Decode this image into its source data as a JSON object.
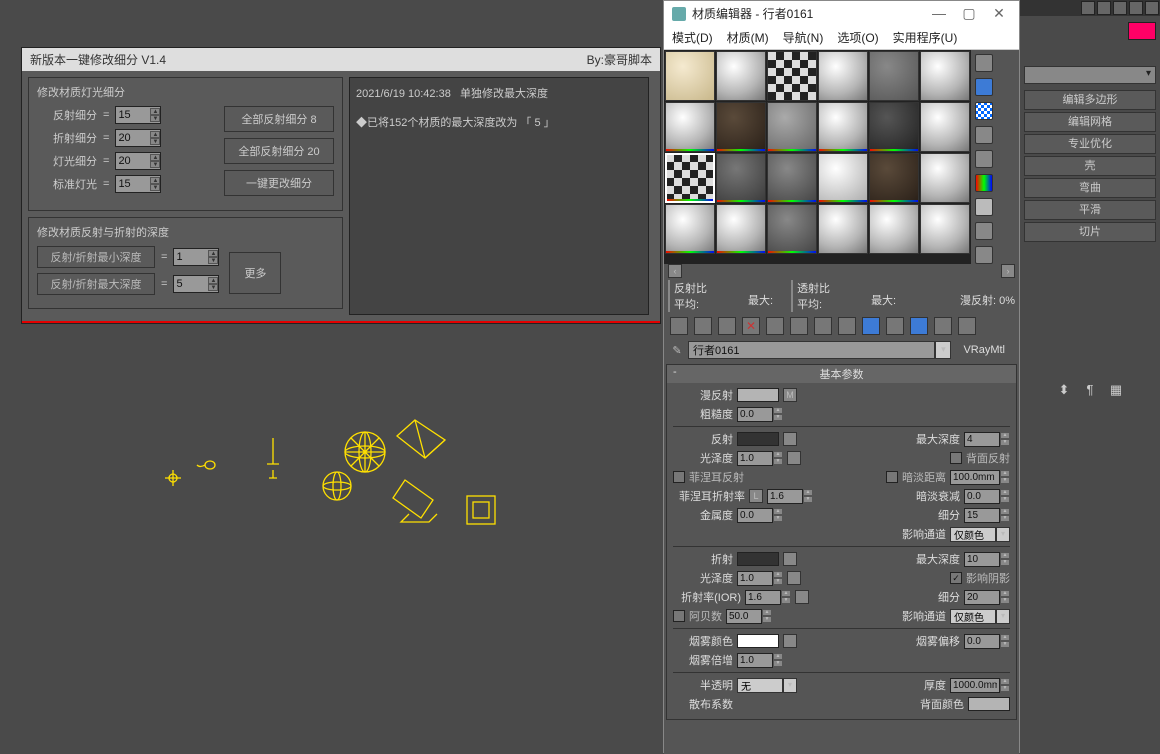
{
  "script_panel": {
    "title": "新版本一键修改细分 V1.4",
    "author": "By:豪哥脚本",
    "group1_title": "修改材质灯光细分",
    "reflect_sub_label": "反射细分",
    "reflect_sub_value": "15",
    "refract_sub_label": "折射细分",
    "refract_sub_value": "20",
    "light_sub_label": "灯光细分",
    "light_sub_value": "20",
    "std_light_label": "标准灯光",
    "std_light_value": "15",
    "btn_all_reflect_8": "全部反射细分 8",
    "btn_all_reflect_20": "全部反射细分 20",
    "btn_onekey": "一键更改细分",
    "group2_title": "修改材质反射与折射的深度",
    "min_depth_label": "反射/折射最小深度",
    "min_depth_value": "1",
    "max_depth_label": "反射/折射最大深度",
    "max_depth_value": "5",
    "btn_more": "更多",
    "log_timestamp": "2021/6/19 10:42:38",
    "log_line1": "单独修改最大深度",
    "log_line2": "◆已将152个材质的最大深度改为 「 5 」"
  },
  "matwin": {
    "title": "材质编辑器 - 行者0161",
    "menu": {
      "mode": "模式(D)",
      "material": "材质(M)",
      "nav": "导航(N)",
      "options": "选项(O)",
      "util": "实用程序(U)"
    },
    "reflect_ratio": "反射比",
    "refract_ratio": "透射比",
    "avg": "平均:",
    "max": "最大:",
    "diffuse_pct_label": "漫反射:",
    "diffuse_pct_value": "0%",
    "mat_name": "行者0161",
    "mat_type": "VRayMtl",
    "rollout_basic": "基本参数",
    "p_diffuse": "漫反射",
    "p_diffuse_m": "M",
    "p_rough": "粗糙度",
    "p_rough_v": "0.0",
    "p_reflect": "反射",
    "p_maxdepth": "最大深度",
    "p_maxdepth_reflect_v": "4",
    "p_gloss": "光泽度",
    "p_gloss_v": "1.0",
    "p_backface": "背面反射",
    "p_fresnel": "菲涅耳反射",
    "p_dimdist": "暗淡距离",
    "p_dimdist_v": "100.0mm",
    "p_fresnel_ior": "菲涅耳折射率",
    "p_fresnel_ior_l": "L",
    "p_fresnel_ior_v": "1.6",
    "p_dimfall": "暗淡衰减",
    "p_dimfall_v": "0.0",
    "p_metal": "金属度",
    "p_metal_v": "0.0",
    "p_subdiv": "细分",
    "p_subdiv_reflect_v": "15",
    "p_affect": "影响通道",
    "p_affect_v": "仅颜色",
    "p_refract": "折射",
    "p_maxdepth_refract_v": "10",
    "p_gloss2_v": "1.0",
    "p_shadow": "影响阴影",
    "p_ior": "折射率(IOR)",
    "p_ior_v": "1.6",
    "p_subdiv_refract_v": "20",
    "p_abbe": "阿贝数",
    "p_abbe_v": "50.0",
    "p_fogcolor": "烟雾颜色",
    "p_fogbias": "烟雾偏移",
    "p_fogbias_v": "0.0",
    "p_fogmult": "烟雾倍增",
    "p_fogmult_v": "1.0",
    "p_translucent": "半透明",
    "p_translucent_v": "无",
    "p_thickness": "厚度",
    "p_thickness_v": "1000.0mm",
    "p_scatter": "散布系数",
    "p_backcolor": "背面颜色"
  },
  "rightbar": {
    "btn_editpoly": "编辑多边形",
    "btn_editmesh": "编辑网格",
    "btn_prooptim": "专业优化",
    "btn_shell": "壳",
    "btn_bend": "弯曲",
    "btn_smooth": "平滑",
    "btn_slice": "切片"
  }
}
